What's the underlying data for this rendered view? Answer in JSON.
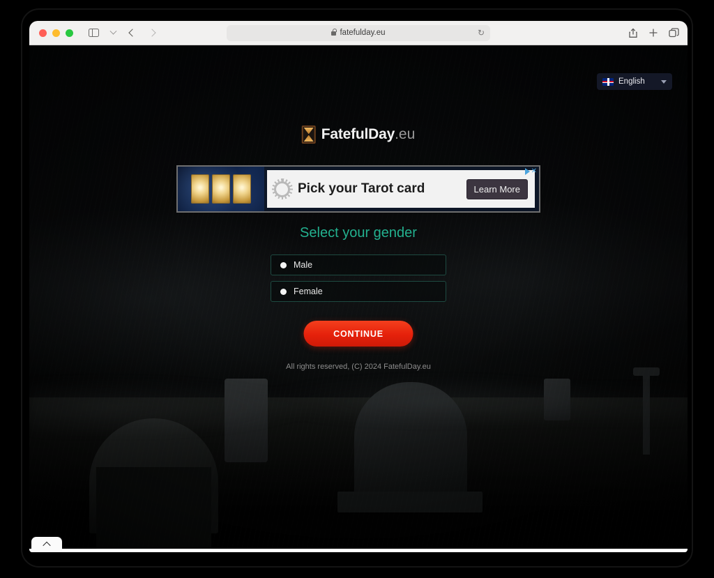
{
  "browser": {
    "window_controls": [
      "close",
      "minimize",
      "maximize"
    ],
    "sidebar_icon": "sidebar-toggle-icon",
    "tab_overflow_icon": "chevron-down-icon",
    "back_icon": "back-arrow-icon",
    "forward_icon": "forward-arrow-icon",
    "url": "fatefulday.eu",
    "lock_icon": "lock-icon",
    "reload_icon": "reload-icon",
    "reload_glyph": "↻",
    "share_icon": "share-icon",
    "share_glyph": "↑",
    "new_tab_icon": "plus-icon",
    "new_tab_glyph": "+",
    "tabs_overview_icon": "tabs-overview-icon"
  },
  "page": {
    "language_selector": {
      "flag": "uk-flag-icon",
      "label": "English",
      "caret": "chevron-down-icon"
    },
    "logo": {
      "icon": "hourglass-icon",
      "name": "FatefulDay",
      "tld": ".eu"
    },
    "ad": {
      "headline": "Pick your Tarot card",
      "cta": "Learn More",
      "icon": "sun-icon",
      "cards_icon": "tarot-cards-icon",
      "adchoices_icon": "adchoices-icon",
      "close_icon": "close-icon",
      "close_glyph": "✕"
    },
    "form": {
      "heading": "Select your gender",
      "options": [
        {
          "label": "Male",
          "radio": "radio-filled-icon"
        },
        {
          "label": "Female",
          "radio": "radio-filled-icon"
        }
      ],
      "submit_label": "CONTINUE"
    },
    "footer": "All rights reserved, (C) 2024 FatefulDay.eu",
    "bottom_tab_icon": "chevron-up-icon"
  },
  "colors": {
    "heading_teal": "#23b18f",
    "option_border": "#1e4a41",
    "continue_red": "#e5210b",
    "lang_bg": "#141827",
    "page_bg": "#050607"
  }
}
